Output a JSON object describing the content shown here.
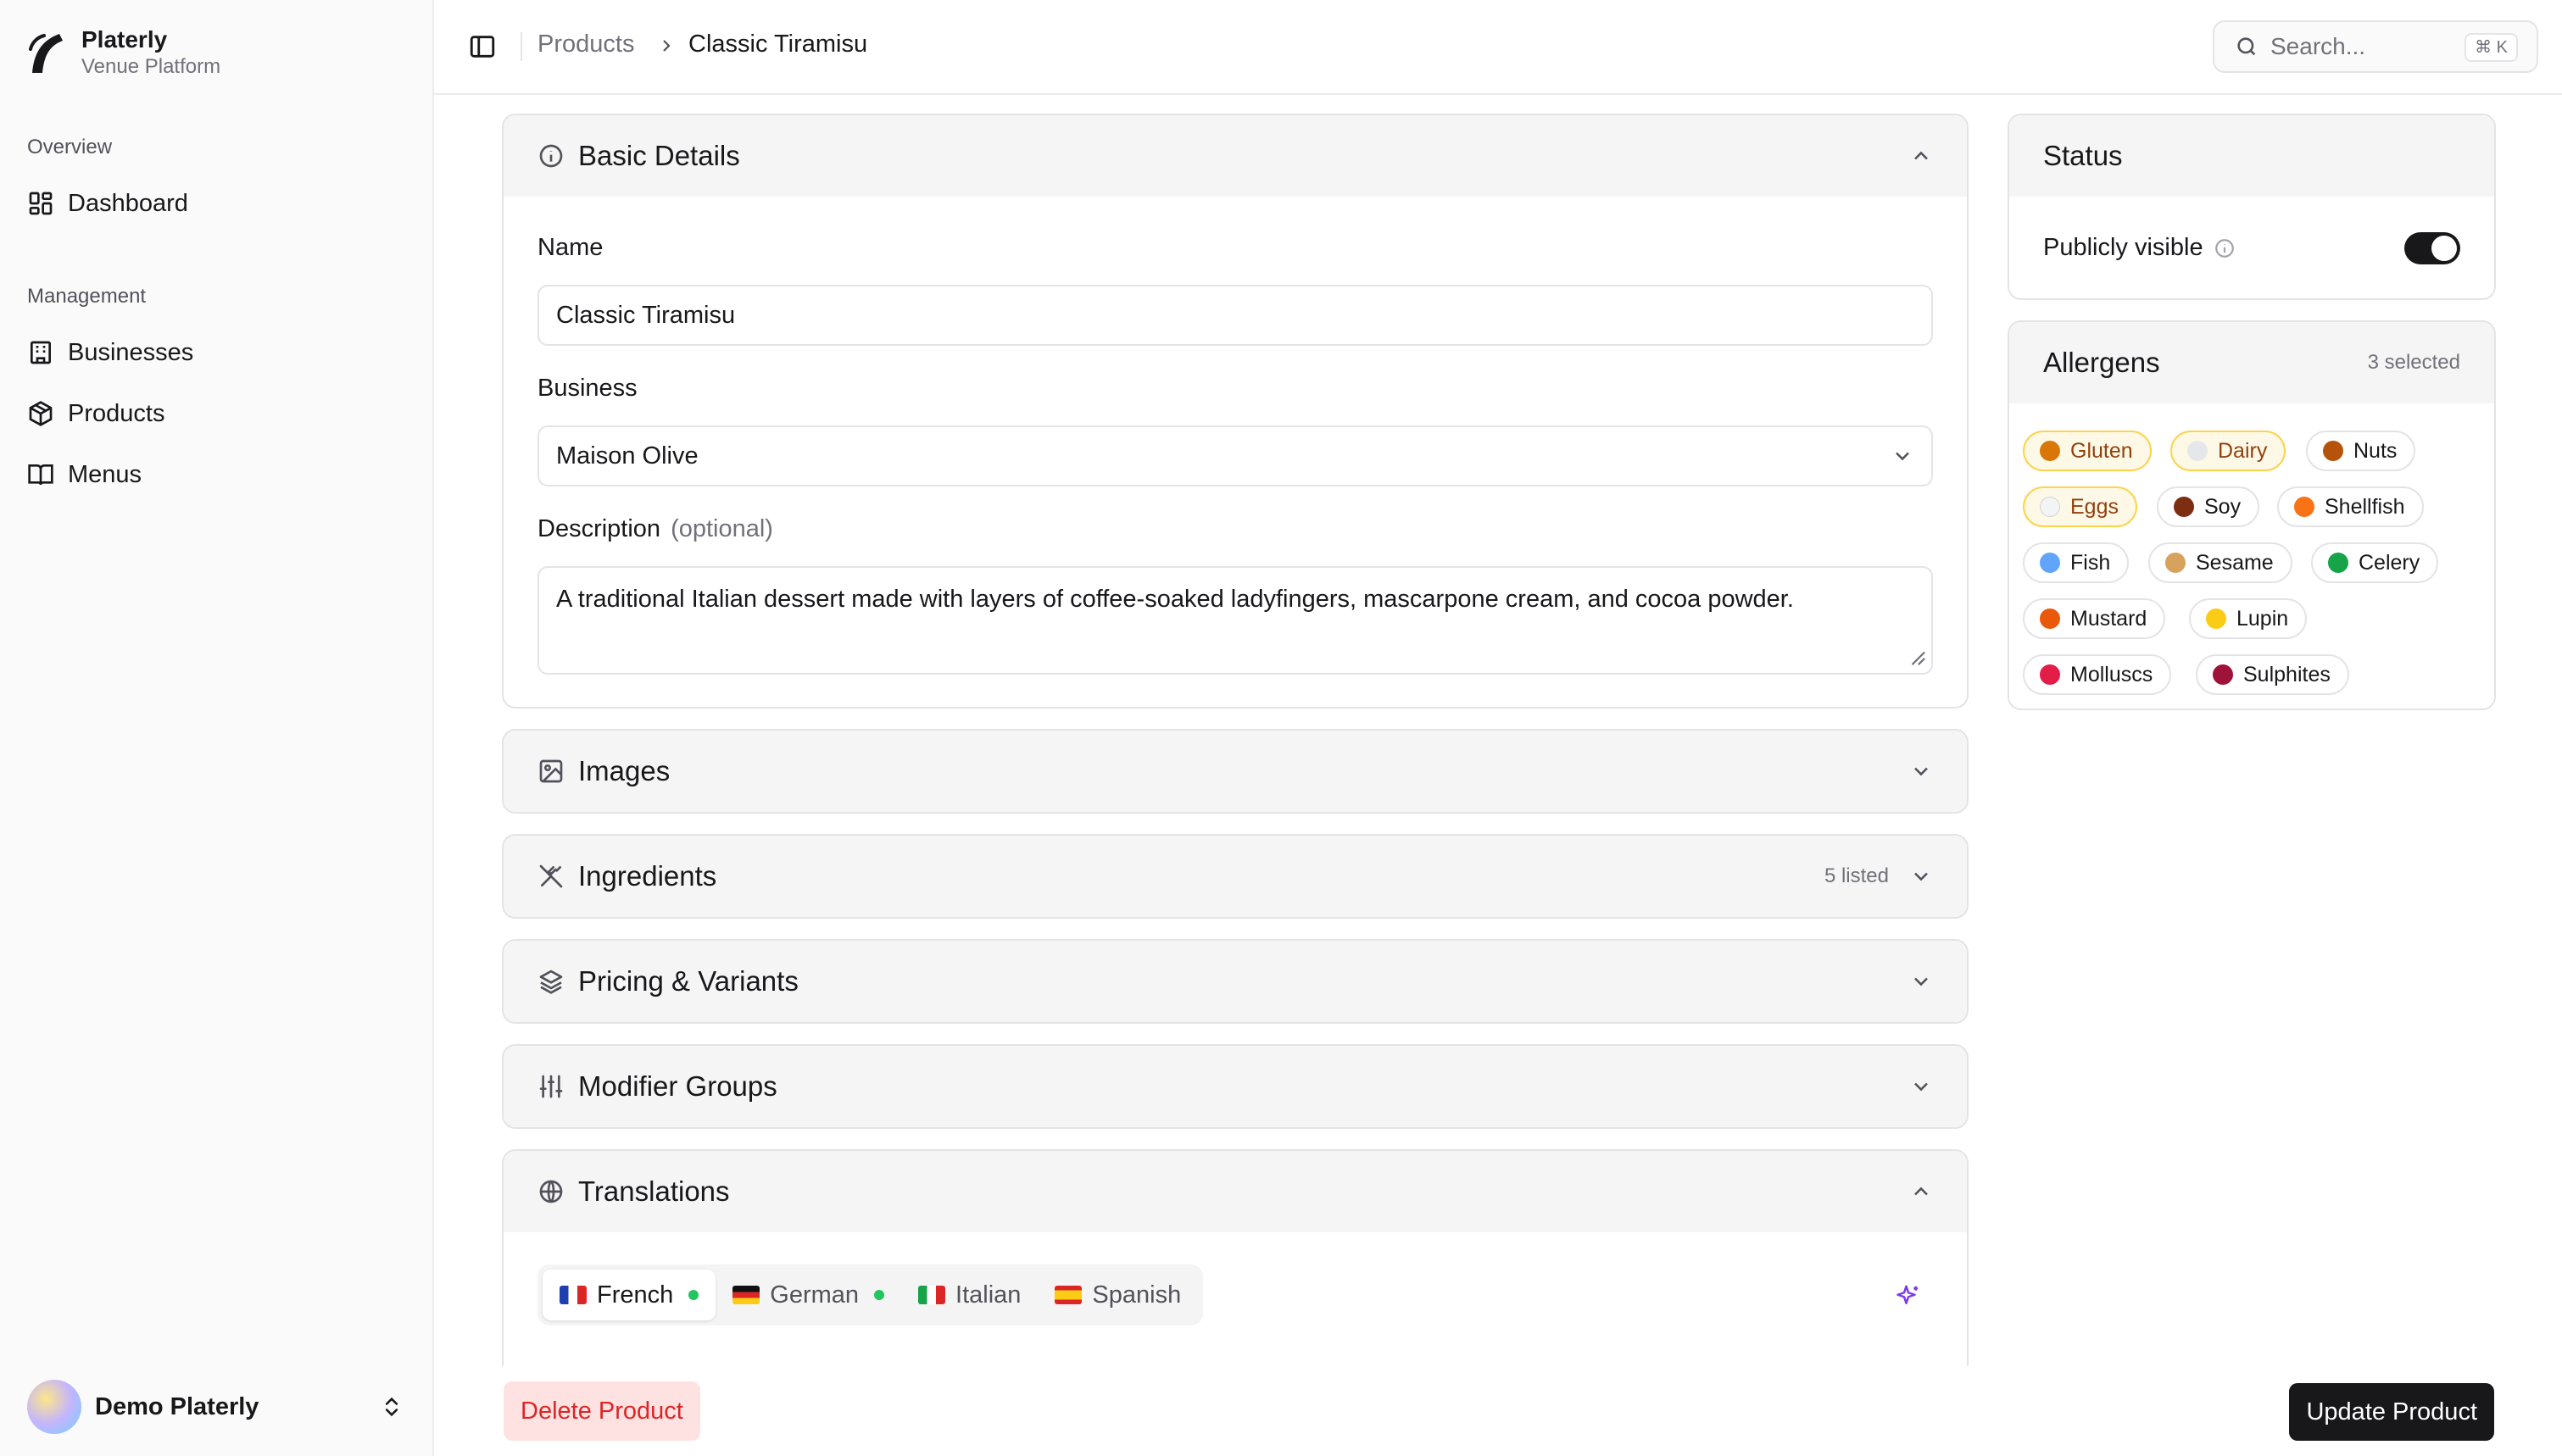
{
  "brand": {
    "name": "Platerly",
    "subtitle": "Venue Platform"
  },
  "sidebar": {
    "groups": [
      {
        "label": "Overview",
        "items": [
          {
            "label": "Dashboard",
            "icon": "dashboard-icon"
          }
        ]
      },
      {
        "label": "Management",
        "items": [
          {
            "label": "Businesses",
            "icon": "building-icon"
          },
          {
            "label": "Products",
            "icon": "package-icon"
          },
          {
            "label": "Menus",
            "icon": "book-open-icon"
          }
        ]
      }
    ],
    "user": {
      "name": "Demo Platerly"
    }
  },
  "topbar": {
    "breadcrumb": [
      "Products",
      "Classic Tiramisu"
    ],
    "search": {
      "placeholder": "Search...",
      "shortcut": "⌘ K"
    }
  },
  "basic_details": {
    "title": "Basic Details",
    "name_label": "Name",
    "name_value": "Classic Tiramisu",
    "business_label": "Business",
    "business_value": "Maison Olive",
    "description_label": "Description",
    "description_optional": "(optional)",
    "description_value": "A traditional Italian dessert made with layers of coffee-soaked ladyfingers, mascarpone cream, and cocoa powder."
  },
  "sections": {
    "images": {
      "title": "Images"
    },
    "ingredients": {
      "title": "Ingredients",
      "meta": "5 listed"
    },
    "pricing": {
      "title": "Pricing & Variants"
    },
    "modifiers": {
      "title": "Modifier Groups"
    }
  },
  "translations": {
    "title": "Translations",
    "tabs": [
      {
        "label": "French",
        "done": true,
        "active": true
      },
      {
        "label": "German",
        "done": true,
        "active": false
      },
      {
        "label": "Italian",
        "done": false,
        "active": false
      },
      {
        "label": "Spanish",
        "done": false,
        "active": false
      }
    ]
  },
  "status": {
    "title": "Status",
    "visibility_label": "Publicly visible",
    "visible": true
  },
  "allergens": {
    "title": "Allergens",
    "meta": "3 selected",
    "items": [
      {
        "label": "Gluten",
        "selected": true
      },
      {
        "label": "Dairy",
        "selected": true
      },
      {
        "label": "Nuts",
        "selected": false
      },
      {
        "label": "Eggs",
        "selected": true
      },
      {
        "label": "Soy",
        "selected": false
      },
      {
        "label": "Shellfish",
        "selected": false
      },
      {
        "label": "Fish",
        "selected": false
      },
      {
        "label": "Sesame",
        "selected": false
      },
      {
        "label": "Celery",
        "selected": false
      },
      {
        "label": "Mustard",
        "selected": false
      },
      {
        "label": "Lupin",
        "selected": false
      },
      {
        "label": "Molluscs",
        "selected": false
      },
      {
        "label": "Sulphites",
        "selected": false
      }
    ]
  },
  "actions": {
    "delete_label": "Delete Product",
    "update_label": "Update Product"
  },
  "colors": {
    "accent": "#18181b",
    "danger": "#dc2626",
    "danger_bg": "#fee2e2",
    "success": "#22c55e",
    "selected_chip": "#fef9e7"
  }
}
